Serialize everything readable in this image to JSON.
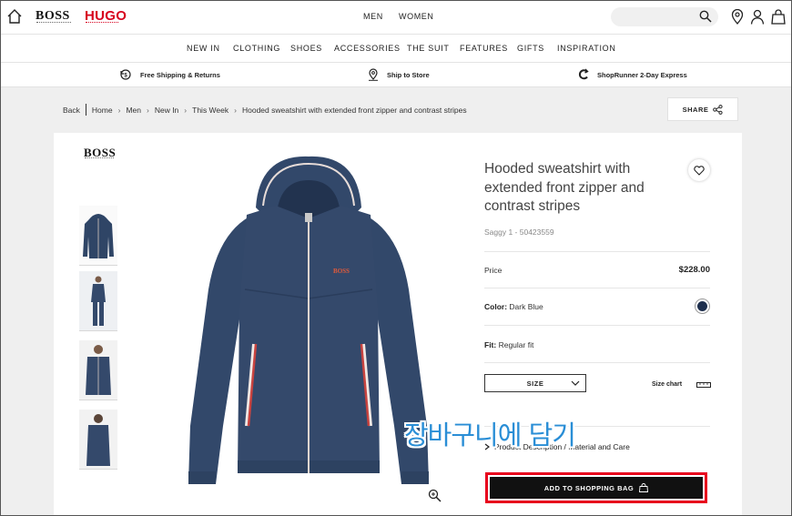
{
  "header": {
    "logo_boss": "BOSS",
    "logo_hugo": "HUGO",
    "gender_tabs": [
      "MEN",
      "WOMEN"
    ],
    "search": {
      "placeholder": ""
    }
  },
  "nav": {
    "items": [
      "NEW IN",
      "CLOTHING",
      "SHOES",
      "ACCESSORIES",
      "THE SUIT",
      "FEATURES",
      "GIFTS",
      "INSPIRATION"
    ]
  },
  "promo": {
    "shipping": "Free Shipping & Returns",
    "store": "Ship to Store",
    "shoprunner": "ShopRunner 2-Day Express"
  },
  "breadcrumb": {
    "back": "Back",
    "items": [
      "Home",
      "Men",
      "New In",
      "This Week",
      "Hooded sweatshirt with extended front zipper and contrast stripes"
    ]
  },
  "share_label": "SHARE",
  "product": {
    "brand_logo": "BOSS",
    "title": "Hooded sweatshirt with extended front zipper and contrast stripes",
    "sku": "Saggy 1 - 50423559",
    "price_label": "Price",
    "price": "$228.00",
    "color_label": "Color:",
    "color_value": "Dark Blue",
    "swatch_color": "#1e2f4d",
    "fit_label": "Fit:",
    "fit_value": "Regular fit",
    "size_label": "SIZE",
    "size_chart": "Size chart",
    "description_link": "Product Description / Material and Care",
    "add_to_bag": "ADD TO SHOPPING BAG"
  },
  "annotation": {
    "korean_caption": "장바구니에 담기",
    "highlight_color": "#e8001c"
  }
}
